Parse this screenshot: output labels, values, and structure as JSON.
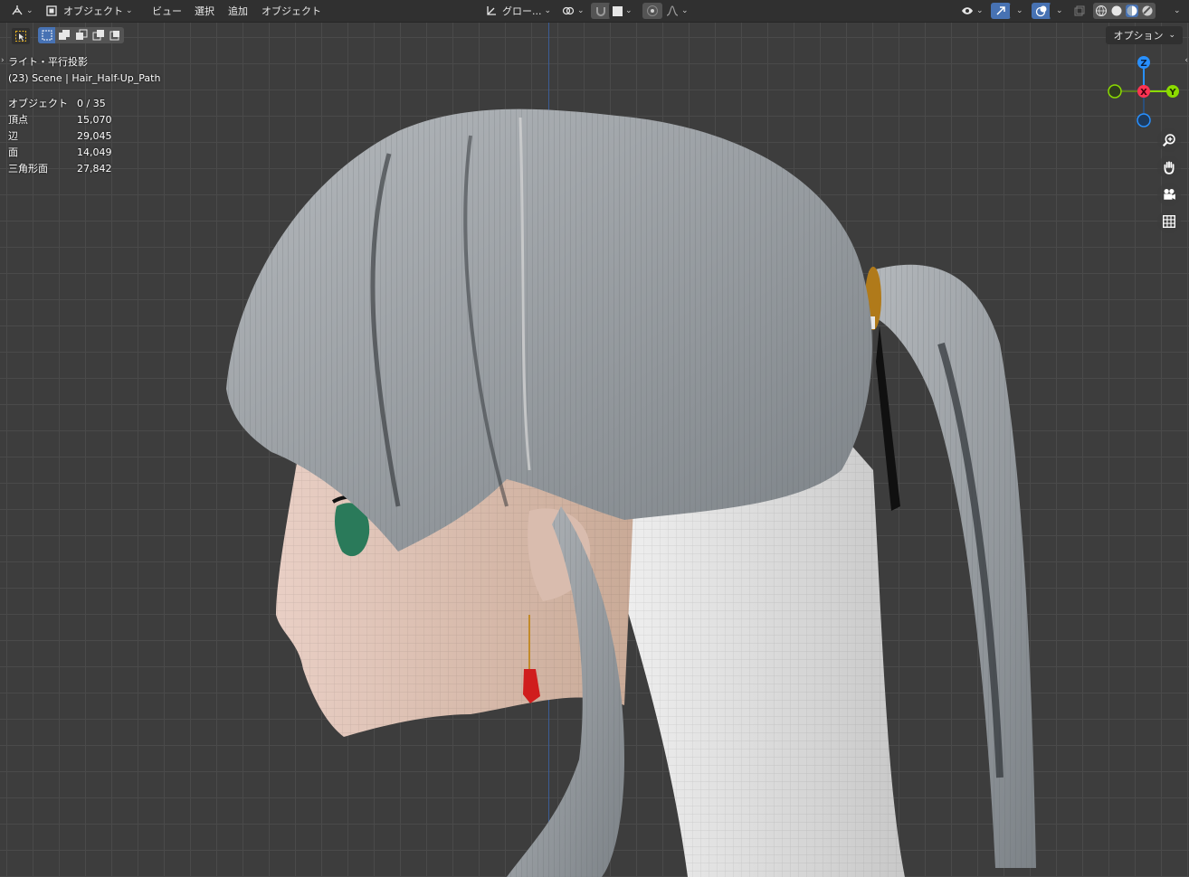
{
  "header": {
    "editor_type_icon": "3d-viewport-icon",
    "mode_label": "オブジェクト",
    "menus": [
      "ビュー",
      "選択",
      "追加",
      "オブジェクト"
    ],
    "transform_orientation": "グロー...",
    "shading_modes": [
      "wireframe",
      "solid",
      "material",
      "rendered"
    ]
  },
  "toolbar": {
    "options_label": "オプション"
  },
  "overlay": {
    "view_name": "ライト・平行投影",
    "scene_info": "(23) Scene | Hair_Half-Up_Path",
    "stats": [
      {
        "label": "オブジェクト",
        "value": "0 / 35"
      },
      {
        "label": "頂点",
        "value": "15,070"
      },
      {
        "label": "辺",
        "value": "29,045"
      },
      {
        "label": "面",
        "value": "14,049"
      },
      {
        "label": "三角形面",
        "value": "27,842"
      }
    ]
  },
  "gizmo": {
    "z_label": "Z",
    "x_label": "X",
    "y_label": "Y",
    "colors": {
      "x": "#ff3352",
      "y": "#8bdc00",
      "z": "#2890ff"
    }
  },
  "colors": {
    "accent": "#4772b3",
    "viewport_bg": "#3d3d3d",
    "header_bg": "#303030"
  }
}
